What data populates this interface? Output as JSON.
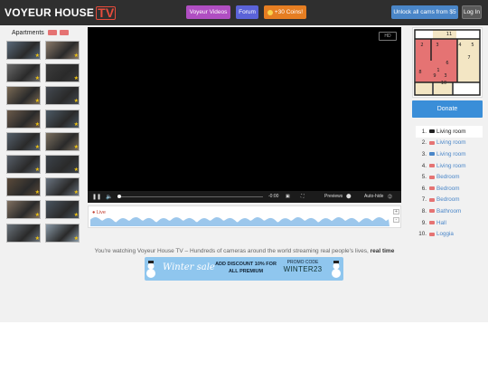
{
  "header": {
    "logo_text": "VOYEUR HOUSE",
    "logo_tv": "TV",
    "btn_videos": "Voyeur Videos",
    "btn_forum": "Forum",
    "btn_coins": "+30 Coins!",
    "btn_unlock": "Unlock all cams from $5",
    "btn_login": "Log In"
  },
  "sidebar": {
    "title": "Apartments",
    "thumb_colors": [
      "#5a6a7a",
      "#8a7a6a",
      "#6a6a6a",
      "#3c3c3c",
      "#7a6a55",
      "#444a52",
      "#6b5a4a",
      "#4c5a66",
      "#55606b",
      "#7b7060",
      "#58606a",
      "#3c434b",
      "#5a4a3a",
      "#6a7480",
      "#807060",
      "#4a5560",
      "#6b747c",
      "#8a9aa8"
    ]
  },
  "player": {
    "badge": "HD",
    "time": "-0:00",
    "previews_label": "Previews",
    "autohide_label": "Auto-hide",
    "live_label": "Live"
  },
  "tagline": {
    "text": "You're watching Voyeur House TV – Hundreds of cameras around the world streaming real people's lives,",
    "bold": "real time"
  },
  "banner": {
    "winter": "Winter sale",
    "discount": "ADD DISCOUNT 10% FOR ALL PREMIUM",
    "promo_label": "PROMO CODE",
    "promo_code": "WINTER23"
  },
  "map": {
    "labels": [
      "11",
      "2",
      "3",
      "4",
      "5",
      "6",
      "7",
      "8",
      "9",
      "10",
      "1",
      "3"
    ]
  },
  "donate": "Donate",
  "rooms": [
    {
      "num": "1.",
      "label": "Living room",
      "cam_color": "#222222",
      "active": true
    },
    {
      "num": "2.",
      "label": "Living room",
      "cam_color": "#e57373",
      "active": false
    },
    {
      "num": "3.",
      "label": "Living room",
      "cam_color": "#4a86c8",
      "active": false
    },
    {
      "num": "4.",
      "label": "Living room",
      "cam_color": "#e57373",
      "active": false
    },
    {
      "num": "5.",
      "label": "Bedroom",
      "cam_color": "#e57373",
      "active": false
    },
    {
      "num": "6.",
      "label": "Bedroom",
      "cam_color": "#e57373",
      "active": false
    },
    {
      "num": "7.",
      "label": "Bedroom",
      "cam_color": "#e57373",
      "active": false
    },
    {
      "num": "8.",
      "label": "Bathroom",
      "cam_color": "#e57373",
      "active": false
    },
    {
      "num": "9.",
      "label": "Hall",
      "cam_color": "#e57373",
      "active": false
    },
    {
      "num": "10.",
      "label": "Loggia",
      "cam_color": "#e57373",
      "active": false
    }
  ]
}
